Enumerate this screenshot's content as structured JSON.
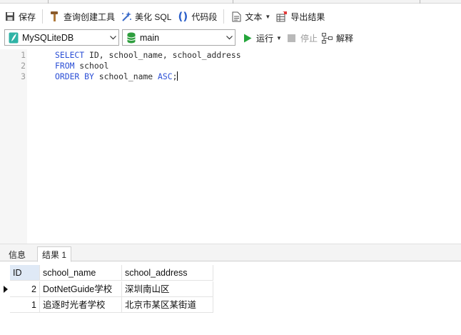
{
  "toolbar": {
    "save": "保存",
    "query_builder": "查询创建工具",
    "beautify_sql": "美化 SQL",
    "code_snippet": "代码段",
    "text": "文本",
    "export_result": "导出结果"
  },
  "connection": {
    "selected": "MySQLiteDB"
  },
  "database": {
    "selected": "main"
  },
  "run": {
    "run": "运行",
    "stop": "停止",
    "explain": "解释"
  },
  "editor": {
    "lines": [
      {
        "num": "1",
        "kw": "SELECT",
        "rest": " ID, school_name, school_address"
      },
      {
        "num": "2",
        "kw": "FROM",
        "rest": " school"
      },
      {
        "num": "3",
        "kw": "ORDER BY",
        "rest": " school_name ",
        "kw2": "ASC",
        "tail": ";"
      }
    ]
  },
  "result_tabs": [
    {
      "label": "信息"
    },
    {
      "label": "结果 1"
    }
  ],
  "grid": {
    "columns": [
      "ID",
      "school_name",
      "school_address"
    ],
    "rows": [
      [
        "2",
        "DotNetGuide学校",
        "深圳南山区"
      ],
      [
        "1",
        "追逐时光者学校",
        "北京市某区某街道"
      ]
    ]
  },
  "colors": {
    "keyword": "#2b4fd6",
    "run_green": "#23a53a",
    "db_green": "#2e9e3e",
    "header_highlight": "#dfe9f6"
  }
}
